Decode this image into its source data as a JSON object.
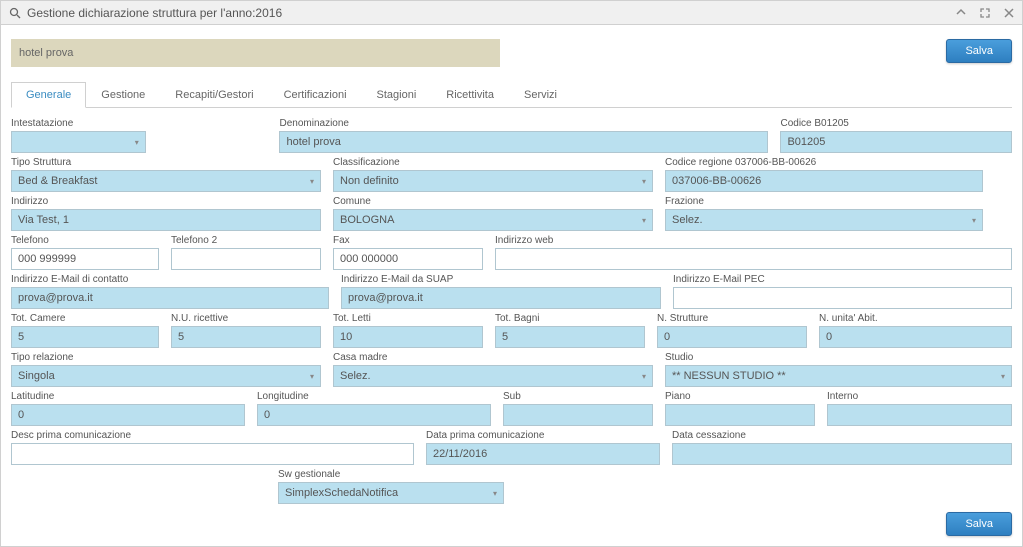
{
  "window": {
    "title": "Gestione dichiarazione struttura per l'anno:2016"
  },
  "header": {
    "name": "hotel prova",
    "save": "Salva"
  },
  "tabs": [
    {
      "label": "Generale"
    },
    {
      "label": "Gestione"
    },
    {
      "label": "Recapiti/Gestori"
    },
    {
      "label": "Certificazioni"
    },
    {
      "label": "Stagioni"
    },
    {
      "label": "Ricettivita"
    },
    {
      "label": "Servizi"
    }
  ],
  "labels": {
    "intestatazione": "Intestatazione",
    "denominazione": "Denominazione",
    "codice_b": "Codice B01205",
    "tipo_struttura": "Tipo Struttura",
    "classificazione": "Classificazione",
    "codice_regione": "Codice regione 037006-BB-00626",
    "indirizzo": "Indirizzo",
    "comune": "Comune",
    "frazione": "Frazione",
    "telefono": "Telefono",
    "telefono2": "Telefono 2",
    "fax": "Fax",
    "indirizzo_web": "Indirizzo web",
    "email_contatto": "Indirizzo E-Mail di contatto",
    "email_suap": "Indirizzo E-Mail da SUAP",
    "email_pec": "Indirizzo E-Mail PEC",
    "tot_camere": "Tot. Camere",
    "nu_ricettive": "N.U. ricettive",
    "tot_letti": "Tot. Letti",
    "tot_bagni": "Tot. Bagni",
    "n_strutture": "N. Strutture",
    "n_unita_abit": "N. unita' Abit.",
    "tipo_relazione": "Tipo relazione",
    "casa_madre": "Casa madre",
    "studio": "Studio",
    "latitudine": "Latitudine",
    "longitudine": "Longitudine",
    "sub": "Sub",
    "piano": "Piano",
    "interno": "Interno",
    "desc_prima": "Desc prima comunicazione",
    "data_prima": "Data prima comunicazione",
    "data_cessazione": "Data cessazione",
    "sw_gestionale": "Sw gestionale"
  },
  "values": {
    "denominazione": "hotel prova",
    "codice_b": "B01205",
    "tipo_struttura": "Bed & Breakfast",
    "classificazione": "Non definito",
    "codice_regione": "037006-BB-00626",
    "indirizzo": "Via Test, 1",
    "comune": "BOLOGNA",
    "frazione": "Selez.",
    "telefono": "000 999999",
    "telefono2": "",
    "fax": "000 000000",
    "indirizzo_web": "",
    "email_contatto": "prova@prova.it",
    "email_suap": "prova@prova.it",
    "email_pec": "",
    "tot_camere": "5",
    "nu_ricettive": "5",
    "tot_letti": "10",
    "tot_bagni": "5",
    "n_strutture": "0",
    "n_unita_abit": "0",
    "tipo_relazione": "Singola",
    "casa_madre": "Selez.",
    "studio": "** NESSUN STUDIO **",
    "latitudine": "0",
    "longitudine": "0",
    "sub": "",
    "piano": "",
    "interno": "",
    "desc_prima": "",
    "data_prima": "22/11/2016",
    "data_cessazione": "",
    "sw_gestionale": "SimplexSchedaNotifica"
  },
  "footer": {
    "save": "Salva"
  }
}
